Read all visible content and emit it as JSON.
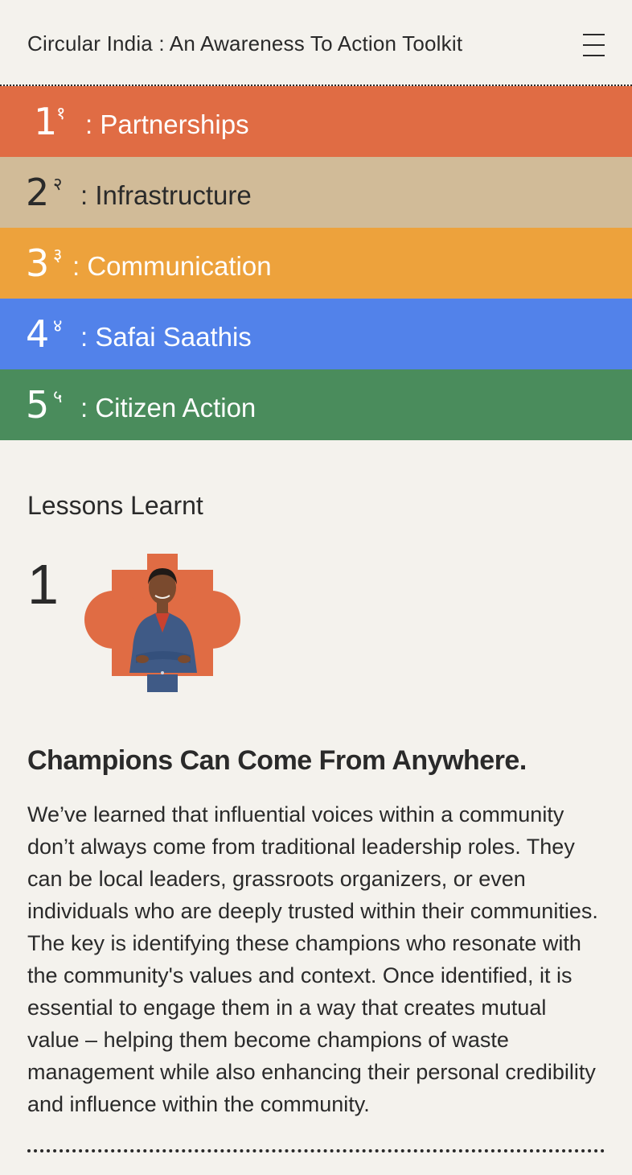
{
  "header": {
    "title": "Circular India : An Awareness To Action Toolkit",
    "menu_icon": "hamburger-menu-icon"
  },
  "nav": [
    {
      "number": "1",
      "devanagari": "१",
      "label": ": Partnerships",
      "color": "#e06c44",
      "text_color": "#ffffff"
    },
    {
      "number": "2",
      "devanagari": "२",
      "label": ": Infrastructure",
      "color": "#d1bb98",
      "text_color": "#2a2a2a"
    },
    {
      "number": "3",
      "devanagari": "३",
      "label": ": Communication",
      "color": "#eda23c",
      "text_color": "#ffffff"
    },
    {
      "number": "4",
      "devanagari": "४",
      "label": ": Safai Saathis",
      "color": "#5282ea",
      "text_color": "#ffffff"
    },
    {
      "number": "5",
      "devanagari": "५",
      "label": ": Citizen Action",
      "color": "#4a8c5c",
      "text_color": "#ffffff"
    }
  ],
  "lessons": {
    "heading": "Lessons Learnt",
    "items": [
      {
        "number": "1",
        "title": "Champions Can Come From Anywhere.",
        "body": "We’ve learned that influential voices within a community don’t always come from traditional leadership roles. They can be local leaders, grassroots organizers, or even individuals who are deeply trusted within their communities. The key is identifying these champions who resonate with the community's values and context. Once identified, it is essential to engage them in a way that creates mutual value – helping them become champions of waste management while also enhancing their personal credibility and influence within the community."
      }
    ]
  },
  "colors": {
    "background": "#f4f2ed",
    "text": "#2a2a2a",
    "portrait_shape": "#e06c44",
    "uniform": "#3f5a86"
  }
}
